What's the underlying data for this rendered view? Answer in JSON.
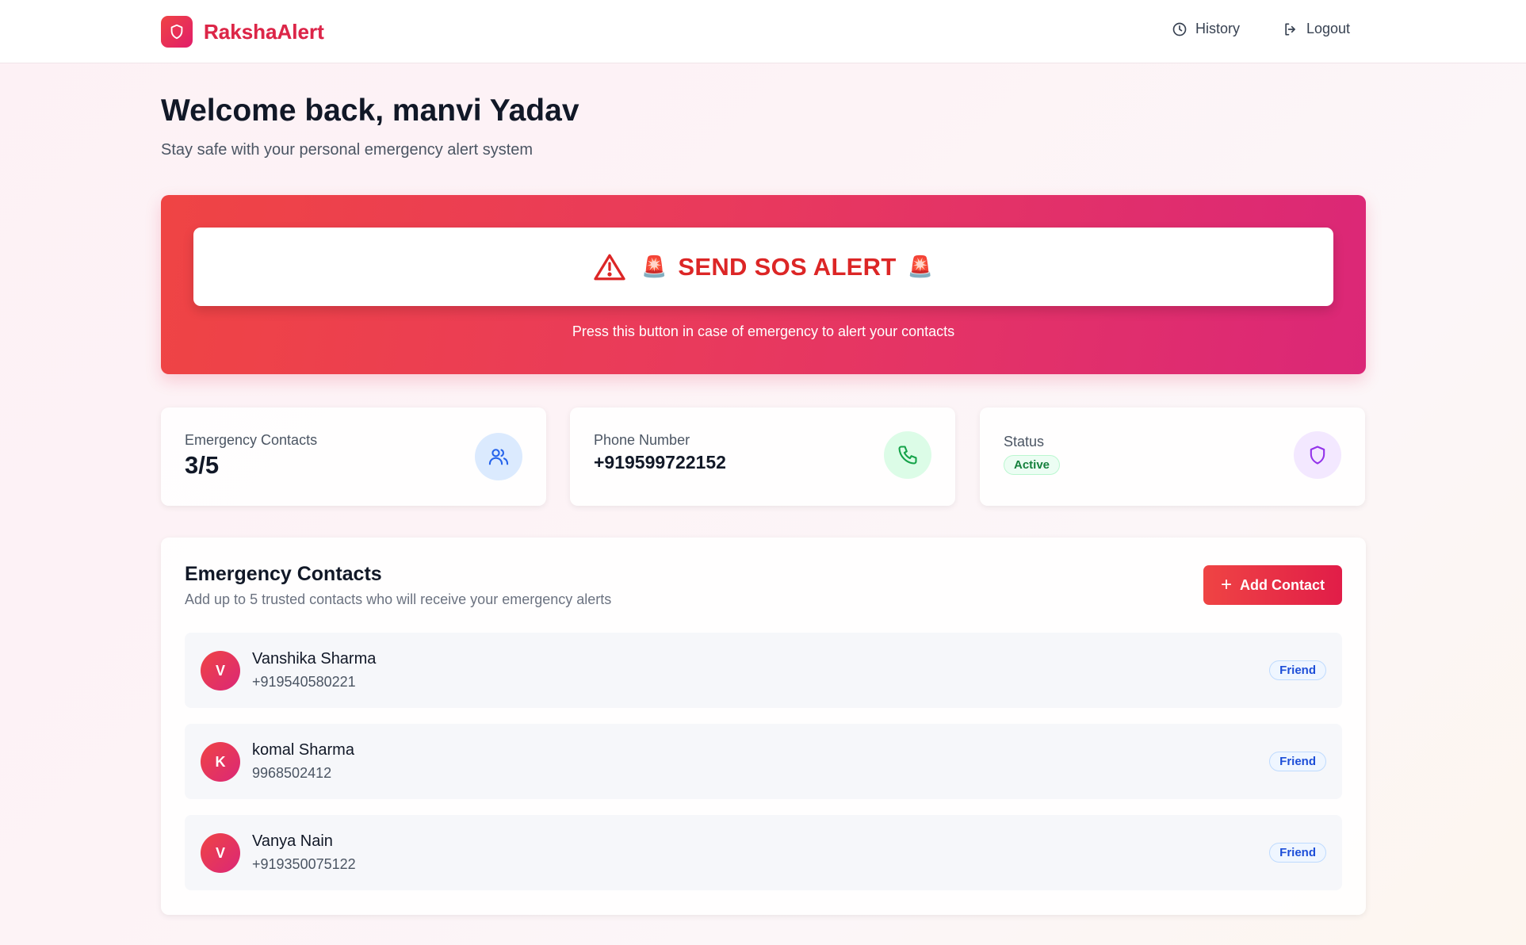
{
  "app": {
    "name": "RakshaAlert",
    "logo_icon": "shield-icon"
  },
  "nav": {
    "history_label": "History",
    "history_icon": "clock-icon",
    "logout_label": "Logout",
    "logout_icon": "logout-icon"
  },
  "welcome": {
    "title": "Welcome back, manvi Yadav",
    "subtitle": "Stay safe with your personal emergency alert system"
  },
  "sos": {
    "button_label": "SEND SOS ALERT",
    "siren_emoji": "🚨",
    "warning_icon": "warning-triangle-icon",
    "hint": "Press this button in case of emergency to alert your contacts"
  },
  "stats": {
    "contacts": {
      "label": "Emergency Contacts",
      "value": "3/5",
      "icon": "users-icon",
      "icon_bg": "#dbeafe",
      "icon_color": "#2563eb"
    },
    "phone": {
      "label": "Phone Number",
      "value": "+919599722152",
      "icon": "phone-icon",
      "icon_bg": "#dcfce7",
      "icon_color": "#16a34a"
    },
    "status": {
      "label": "Status",
      "value": "Active",
      "icon": "shield-icon",
      "icon_bg": "#f3e8ff",
      "icon_color": "#9333ea"
    }
  },
  "contacts_section": {
    "title": "Emergency Contacts",
    "subtitle": "Add up to 5 trusted contacts who will receive your emergency alerts",
    "add_button_label": "Add Contact",
    "items": [
      {
        "initial": "V",
        "name": "Vanshika Sharma",
        "phone": "+919540580221",
        "relation": "Friend"
      },
      {
        "initial": "K",
        "name": "komal Sharma",
        "phone": "9968502412",
        "relation": "Friend"
      },
      {
        "initial": "V",
        "name": "Vanya Nain",
        "phone": "+919350075122",
        "relation": "Friend"
      }
    ]
  },
  "colors": {
    "brand_red": "#dc2626",
    "brand_pink": "#db2777",
    "active_green": "#15803d",
    "tag_blue": "#1d4ed8"
  }
}
